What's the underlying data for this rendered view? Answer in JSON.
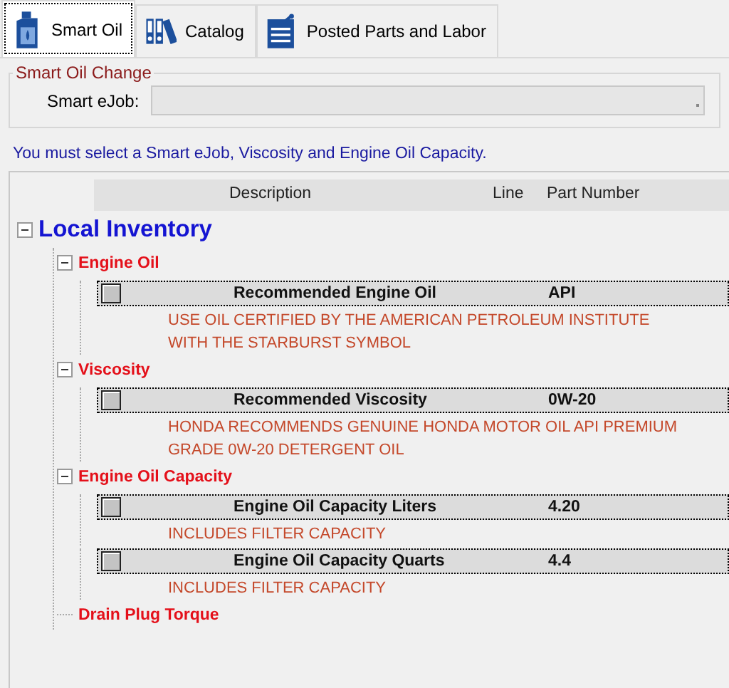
{
  "tabs": [
    {
      "label": "Smart Oil",
      "kind": "bottle",
      "selected": true
    },
    {
      "label": "Catalog",
      "kind": "binders",
      "selected": false
    },
    {
      "label": "Posted Parts and Labor",
      "kind": "clipboard",
      "selected": false
    }
  ],
  "group": {
    "title": "Smart Oil Change",
    "field_label": "Smart eJob:",
    "field_disabled": true
  },
  "message": "You must select a Smart eJob, Viscosity and Engine Oil Capacity.",
  "columns": [
    "Description",
    "Line",
    "Part Number"
  ],
  "tree": {
    "label": "Local Inventory",
    "expanded": true,
    "children": [
      {
        "label": "Engine Oil",
        "expanded": true,
        "items": [
          {
            "description": "Recommended Engine Oil",
            "part_number": "API",
            "checked": false,
            "notes": [
              "USE OIL CERTIFIED BY THE AMERICAN PETROLEUM INSTITUTE",
              "WITH THE STARBURST SYMBOL"
            ]
          }
        ]
      },
      {
        "label": "Viscosity",
        "expanded": true,
        "items": [
          {
            "description": "Recommended Viscosity",
            "part_number": "0W-20",
            "checked": false,
            "notes": [
              "HONDA RECOMMENDS GENUINE HONDA MOTOR OIL API PREMIUM",
              "GRADE 0W-20 DETERGENT OIL"
            ]
          }
        ]
      },
      {
        "label": "Engine Oil Capacity",
        "expanded": true,
        "items": [
          {
            "description": "Engine Oil Capacity Liters",
            "part_number": "4.20",
            "checked": false,
            "notes": [
              "INCLUDES FILTER CAPACITY"
            ]
          },
          {
            "description": "Engine Oil Capacity Quarts",
            "part_number": "4.4",
            "checked": false,
            "notes": [
              "INCLUDES FILTER CAPACITY"
            ]
          }
        ]
      },
      {
        "label": "Drain Plug Torque"
      }
    ]
  }
}
